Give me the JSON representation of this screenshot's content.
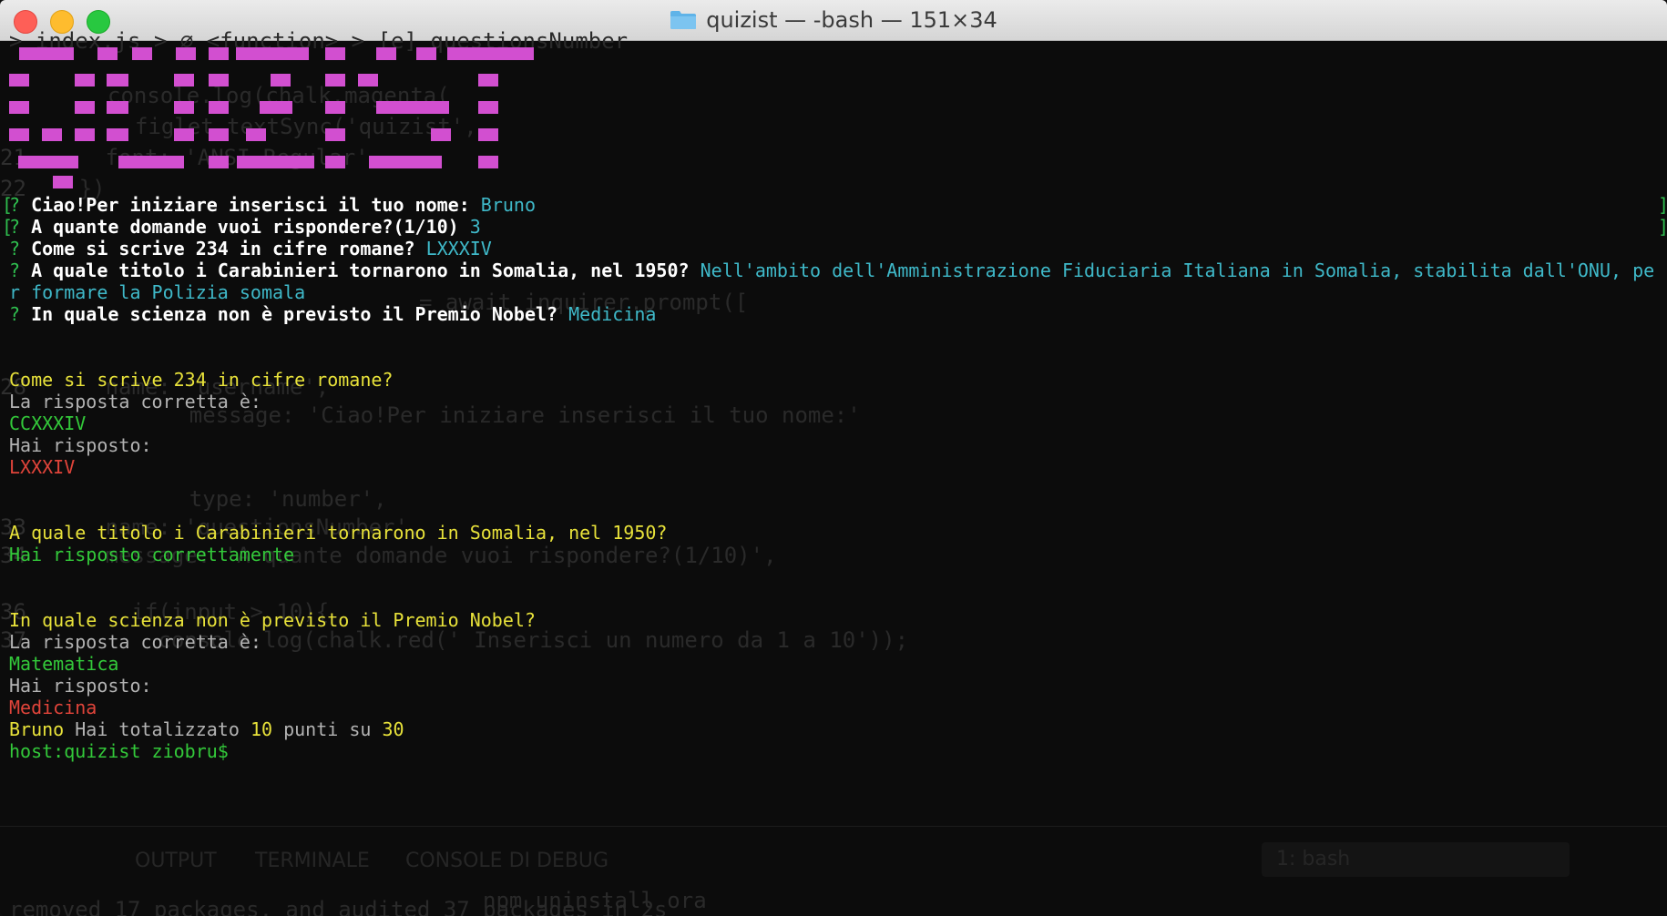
{
  "window": {
    "title": "quizist — -bash — 151×34"
  },
  "background_code": {
    "lines": [
      {
        "num": "21",
        "text": "    font: 'ANSI Regular',"
      },
      {
        "num": "22",
        "text": "  })"
      },
      {
        "num": "28",
        "text": "    name: 'username',"
      },
      {
        "num": "",
        "text": "    message: 'Ciao!Per iniziare inserisci il tuo nome:'"
      },
      {
        "num": "",
        "text": "    type: 'number',"
      },
      {
        "num": "33",
        "text": "    name: 'questionsNumber',"
      },
      {
        "num": "34",
        "text": "    message: 'A quante domande vuoi rispondere?(1/10)',"
      },
      {
        "num": "36",
        "text": "      if(input > 10){"
      },
      {
        "num": "37",
        "text": "        console.log(chalk.red(' Inserisci un numero da 1 a 10'));"
      }
    ],
    "panel_tabs": [
      "OUTPUT",
      "TERMINALE",
      "CONSOLE DI DEBUG"
    ],
    "panel_select": "1: bash",
    "panel_cmd": "npm uninstall ora",
    "panel_out": "removed 17 packages, and audited 37 packages in 2s"
  },
  "terminal": {
    "prompts": [
      {
        "mark": "?",
        "question": "Ciao!Per iniziare inserisci il tuo nome:",
        "answer": "Bruno"
      },
      {
        "mark": "?",
        "question": "A quante domande vuoi rispondere?(1/10)",
        "answer": "3"
      },
      {
        "mark": "?",
        "question": "Come si scrive 234 in cifre romane?",
        "answer": "LXXXIV"
      },
      {
        "mark": "?",
        "question": "A quale titolo i Carabinieri tornarono in Somalia, nel 1950?",
        "answer": "Nell'ambito dell'Amministrazione Fiduciaria Italiana in Somalia, stabilita dall'ONU, pe",
        "answer_cont": "r formare la Polizia somala"
      },
      {
        "mark": "?",
        "question": "In quale scienza non è previsto il Premio Nobel?",
        "answer": "Medicina"
      }
    ],
    "results": {
      "q1": "Come si scrive 234 in cifre romane?",
      "correct_label": "La risposta corretta è:",
      "q1_correct": "CCXXXIV",
      "answered_label": "Hai risposto:",
      "q1_given": "LXXXIV",
      "q2": "A quale titolo i Carabinieri tornarono in Somalia, nel 1950?",
      "q2_ok": "Hai risposto correttamente",
      "q3": "In quale scienza non è previsto il Premio Nobel?",
      "q3_correct": "Matematica",
      "q3_given": "Medicina"
    },
    "summary": {
      "name": "Bruno",
      "text1": "Hai totalizzato",
      "score": "10",
      "text2": "punti su",
      "total": "30"
    },
    "shell_prompt": "host:quizist ziobru$"
  },
  "colors": {
    "logo": "#d24fd0",
    "prompt_mark": "#2fbf4f",
    "answer": "#3fb9c9",
    "question_heading": "#e8e23a",
    "correct": "#33c93a",
    "wrong": "#e0443a"
  }
}
